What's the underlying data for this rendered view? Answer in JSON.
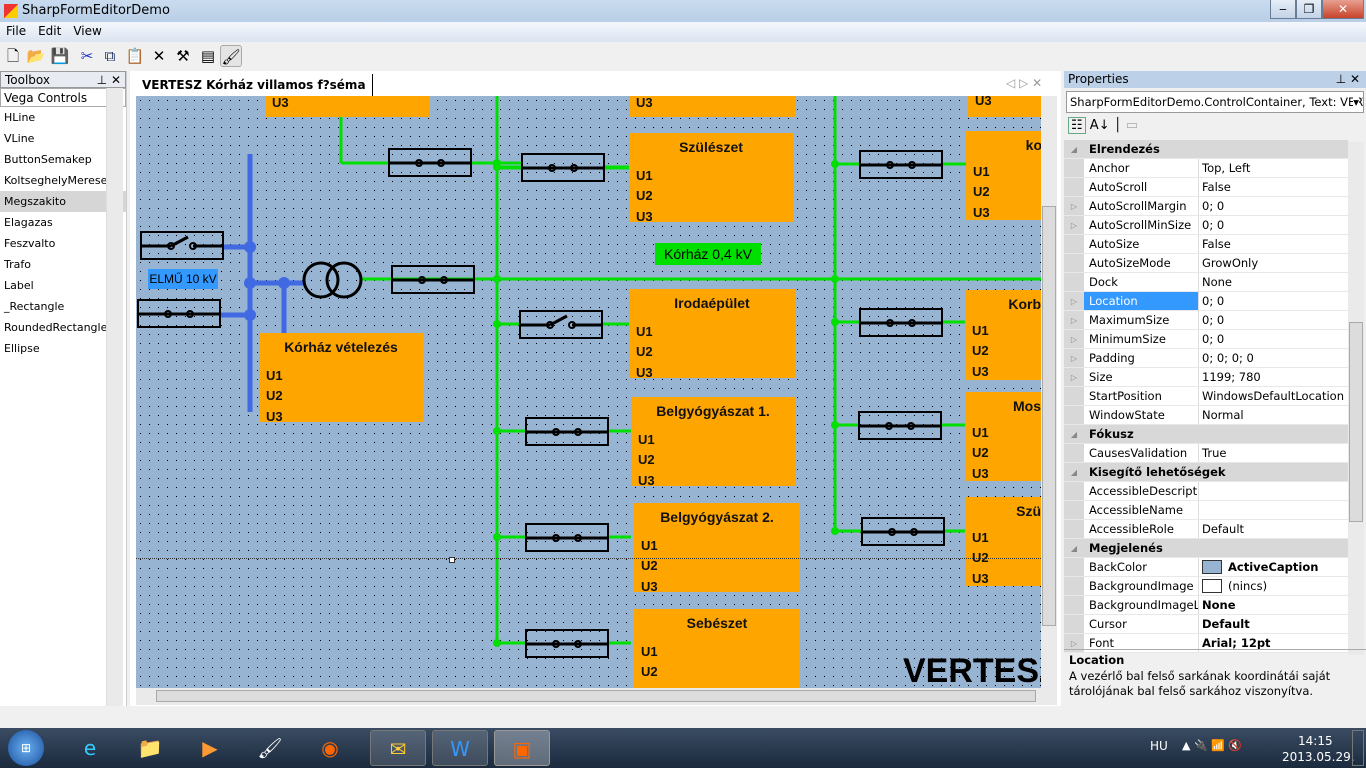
{
  "window": {
    "title": "SharpFormEditorDemo",
    "minimize": "‒",
    "maximize": "❐",
    "close": "✕"
  },
  "menu": [
    "File",
    "Edit",
    "View"
  ],
  "toolbar": [
    "new-icon",
    "open-icon",
    "save-icon",
    "cut-icon",
    "copy-icon",
    "paste-icon",
    "delete-icon",
    "tools-icon",
    "properties-icon",
    "paint-icon"
  ],
  "toolbox": {
    "title": "Toolbox",
    "group": "Vega Controls",
    "items": [
      "HLine",
      "VLine",
      "ButtonSemakep",
      "KoltseghelyMeresek",
      "Megszakito",
      "Elagazas",
      "Feszvalto",
      "Trafo",
      "Label",
      "_Rectangle",
      "RoundedRectangle",
      "Ellipse"
    ],
    "selected": "Megszakito"
  },
  "document": {
    "tab": "VERTESZ Kórház villamos f?séma"
  },
  "diagram": {
    "labels": {
      "source": "ELMŰ 10 kV",
      "bus": "Kórház 0,4 kV",
      "big": "VERTESZ"
    },
    "u": [
      "U1",
      "U2",
      "U3"
    ],
    "boxes": [
      {
        "title": "",
        "rows": [
          "U3"
        ]
      },
      {
        "title": "",
        "rows": [
          "U3"
        ]
      },
      {
        "title": "",
        "rows": [
          "U3"
        ]
      },
      {
        "title": "Szülészet",
        "rows": [
          "U1",
          "U2",
          "U3"
        ]
      },
      {
        "title": "ko",
        "rows": [
          "U1",
          "U2",
          "U3"
        ]
      },
      {
        "title": "Irodaépület",
        "rows": [
          "U1",
          "U2",
          "U3"
        ]
      },
      {
        "title": "Korb",
        "rows": [
          "U1",
          "U2",
          "U3"
        ]
      },
      {
        "title": "Kórház vételezés",
        "rows": [
          "U1",
          "U2",
          "U3"
        ]
      },
      {
        "title": "Belgyógyászat 1.",
        "rows": [
          "U1",
          "U2",
          "U3"
        ]
      },
      {
        "title": "Mos",
        "rows": [
          "U1",
          "U2",
          "U3"
        ]
      },
      {
        "title": "Belgyógyászat 2.",
        "rows": [
          "U1",
          "U2",
          "U3"
        ]
      },
      {
        "title": "Szü",
        "rows": [
          "U1",
          "U2",
          "U3"
        ]
      },
      {
        "title": "Sebészet",
        "rows": [
          "U1",
          "U2",
          "U3"
        ]
      }
    ],
    "colors": {
      "box": "#FFA500",
      "bus": "#00E000",
      "hv": "#4169E1",
      "canvas": "#98B4D3"
    }
  },
  "properties": {
    "title": "Properties",
    "object": "SharpFormEditorDemo.ControlContainer, Text: VERTI",
    "rows": [
      {
        "cat": "Elrendezés"
      },
      {
        "k": "Anchor",
        "v": "Top, Left"
      },
      {
        "k": "AutoScroll",
        "v": "False"
      },
      {
        "k": "AutoScrollMargin",
        "v": "0; 0",
        "exp": true
      },
      {
        "k": "AutoScrollMinSize",
        "v": "0; 0",
        "exp": true
      },
      {
        "k": "AutoSize",
        "v": "False"
      },
      {
        "k": "AutoSizeMode",
        "v": "GrowOnly"
      },
      {
        "k": "Dock",
        "v": "None"
      },
      {
        "k": "Location",
        "v": "0; 0",
        "exp": true,
        "sel": true
      },
      {
        "k": "MaximumSize",
        "v": "0; 0",
        "exp": true
      },
      {
        "k": "MinimumSize",
        "v": "0; 0",
        "exp": true
      },
      {
        "k": "Padding",
        "v": "0; 0; 0; 0",
        "exp": true
      },
      {
        "k": "Size",
        "v": "1199; 780",
        "exp": true
      },
      {
        "k": "StartPosition",
        "v": "WindowsDefaultLocation"
      },
      {
        "k": "WindowState",
        "v": "Normal"
      },
      {
        "cat": "Fókusz"
      },
      {
        "k": "CausesValidation",
        "v": "True"
      },
      {
        "cat": "Kisegítő lehetőségek"
      },
      {
        "k": "AccessibleDescriptio",
        "v": ""
      },
      {
        "k": "AccessibleName",
        "v": ""
      },
      {
        "k": "AccessibleRole",
        "v": "Default"
      },
      {
        "cat": "Megjelenés"
      },
      {
        "k": "BackColor",
        "v": "ActiveCaption",
        "bold": true,
        "swatch": "#98B4D3"
      },
      {
        "k": "BackgroundImage",
        "v": "(nincs)",
        "swatch": "#FFFFFF"
      },
      {
        "k": "BackgroundImageLa",
        "v": "None",
        "bold": true
      },
      {
        "k": "Cursor",
        "v": "Default",
        "bold": true
      },
      {
        "k": "Font",
        "v": "Arial; 12pt",
        "bold": true,
        "exp": true
      }
    ],
    "help_title": "Location",
    "help_text": "A vezérlő bal felső sarkának koordinátái saját tárolójának bal felső sarkához viszonyítva."
  },
  "taskbar": {
    "lang": "HU",
    "time": "14:15",
    "date": "2013.05.29."
  }
}
